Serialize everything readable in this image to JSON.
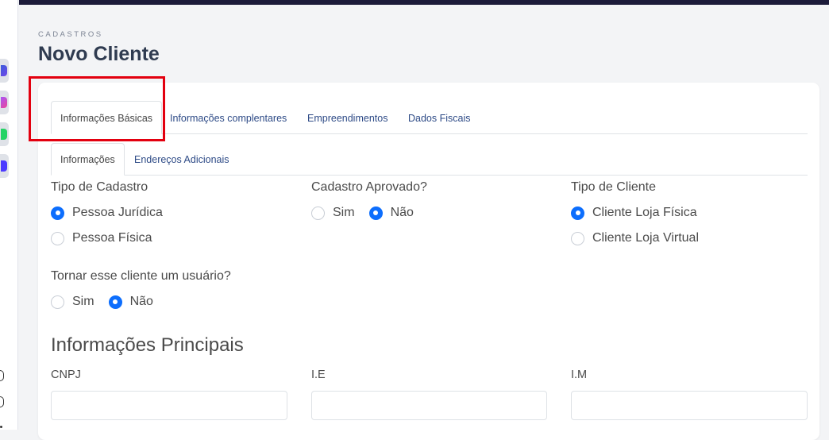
{
  "breadcrumb": "CADASTROS",
  "page_title": "Novo Cliente",
  "main_tabs": [
    {
      "label": "Informações Básicas",
      "active": true
    },
    {
      "label": "Informações complentares",
      "active": false
    },
    {
      "label": "Empreendimentos",
      "active": false
    },
    {
      "label": "Dados Fiscais",
      "active": false
    }
  ],
  "sub_tabs": [
    {
      "label": "Informações",
      "active": true
    },
    {
      "label": "Endereços Adicionais",
      "active": false
    }
  ],
  "groups": {
    "tipo_cadastro": {
      "label": "Tipo de Cadastro",
      "options": [
        {
          "label": "Pessoa Jurídica",
          "checked": true
        },
        {
          "label": "Pessoa Física",
          "checked": false
        }
      ]
    },
    "cadastro_aprovado": {
      "label": "Cadastro Aprovado?",
      "options": [
        {
          "label": "Sim",
          "checked": false
        },
        {
          "label": "Não",
          "checked": true
        }
      ]
    },
    "tipo_cliente": {
      "label": "Tipo de Cliente",
      "options": [
        {
          "label": "Cliente Loja Física",
          "checked": true
        },
        {
          "label": "Cliente Loja Virtual",
          "checked": false
        }
      ]
    },
    "tornar_usuario": {
      "label": "Tornar esse cliente um usuário?",
      "options": [
        {
          "label": "Sim",
          "checked": false
        },
        {
          "label": "Não",
          "checked": true
        }
      ]
    }
  },
  "section": {
    "title": "Informações Principais",
    "fields": [
      {
        "label": "CNPJ",
        "value": ""
      },
      {
        "label": "I.E",
        "value": ""
      },
      {
        "label": "I.M",
        "value": ""
      }
    ]
  },
  "colors": {
    "accent": "#0d6efd",
    "tab_link": "#2d4a86",
    "highlight": "#e3000f",
    "topbar": "#1c1b3a"
  }
}
